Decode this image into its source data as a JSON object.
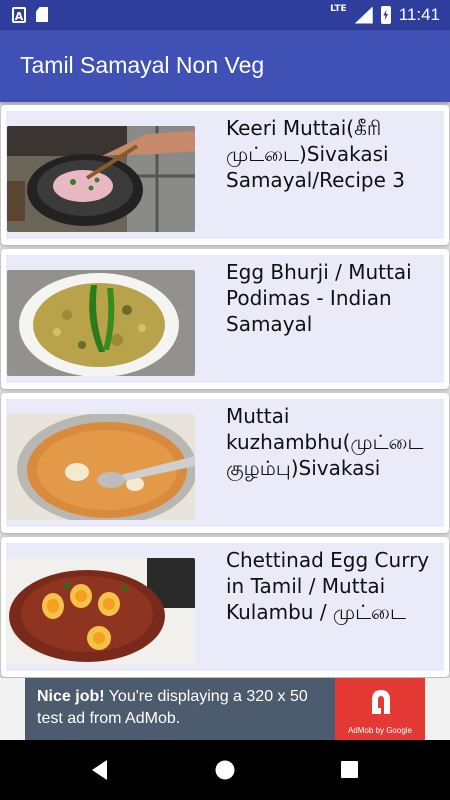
{
  "status": {
    "network": "LTE",
    "time": "11:41"
  },
  "app": {
    "title": "Tamil Samayal Non Veg"
  },
  "items": [
    {
      "title": "Keeri Muttai(கீரி முட்டை)Sivakasi Samayal/Recipe 3"
    },
    {
      "title": "Egg Bhurji / Muttai Podimas - Indian Samayal"
    },
    {
      "title": "Muttai kuzhambhu(முட்டை குழம்பு)Sivakasi"
    },
    {
      "title": "Chettinad Egg Curry in Tamil / Muttai Kulambu / முட்டை"
    }
  ],
  "ad": {
    "headline": "Nice job!",
    "body": " You're displaying a 320 x 50 test ad from AdMob.",
    "brand": "AdMob by Google",
    "accent": "#e53935"
  },
  "colors": {
    "primary": "#3f51b5",
    "primary_dark": "#2f3d9c",
    "card_bg": "#eaeaf8"
  },
  "icons": [
    "back-icon",
    "home-icon",
    "recents-icon",
    "admob-logo-icon"
  ]
}
